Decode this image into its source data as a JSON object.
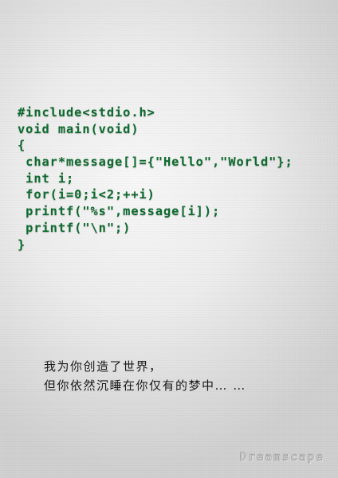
{
  "code_lines": [
    "#include<stdio.h>",
    "void main(void)",
    "{",
    " char*message[]={\"Hello\",\"World\"};",
    " int i;",
    " for(i=0;i<2;++i)",
    " printf(\"%s\",message[i]);",
    " printf(\"\\n\";)",
    "}"
  ],
  "poem_lines": [
    "我为你创造了世界，",
    "但你依然沉睡在你仅有的梦中… …"
  ],
  "signature": "Dreamscape",
  "colors": {
    "code_text": "#0e6b2f",
    "poem_text": "#1a1a1a",
    "background_light": "#f7f7f7",
    "background_dark": "#cfcfcf"
  }
}
